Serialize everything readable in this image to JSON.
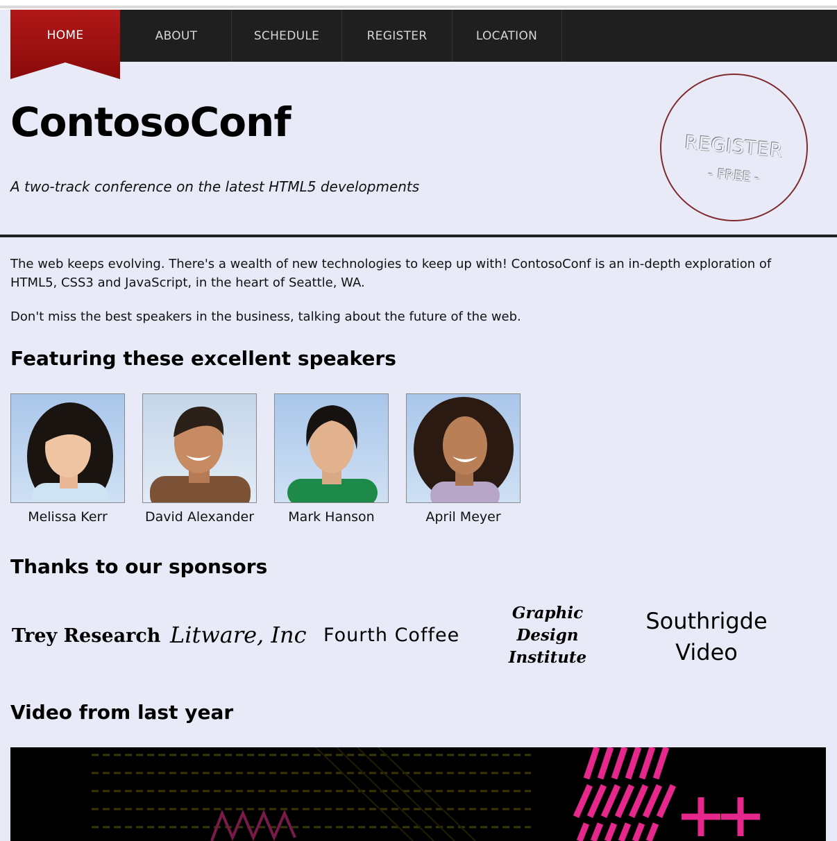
{
  "nav": {
    "items": [
      {
        "label": "HOME",
        "active": true
      },
      {
        "label": "ABOUT",
        "active": false
      },
      {
        "label": "SCHEDULE",
        "active": false
      },
      {
        "label": "REGISTER",
        "active": false
      },
      {
        "label": "LOCATION",
        "active": false
      }
    ]
  },
  "header": {
    "title": "ContosoConf",
    "tagline": "A two-track conference on the latest HTML5 developments",
    "stamp": {
      "main": "REGISTER",
      "sub": "- FREE -"
    }
  },
  "intro": {
    "paragraph1": "The web keeps evolving. There's a wealth of new technologies to keep up with! ContosoConf is an in-depth exploration of HTML5, CSS3 and JavaScript, in the heart of Seattle, WA.",
    "paragraph2": "Don't miss the best speakers in the business, talking about the future of the web."
  },
  "speakers": {
    "heading": "Featuring these excellent speakers",
    "list": [
      {
        "name": "Melissa Kerr"
      },
      {
        "name": "David Alexander"
      },
      {
        "name": "Mark Hanson"
      },
      {
        "name": "April Meyer"
      }
    ]
  },
  "sponsors": {
    "heading": "Thanks to our sponsors",
    "list": [
      {
        "name": "Trey Research"
      },
      {
        "name": "Litware, Inc"
      },
      {
        "name": "Fourth Coffee"
      },
      {
        "name": "Graphic Design Institute",
        "lines": [
          "Graphic",
          "Design",
          "Institute"
        ]
      },
      {
        "name": "Southrigde Video",
        "lines": [
          "Southrigde",
          "Video"
        ]
      }
    ]
  },
  "video": {
    "heading": "Video from last year"
  },
  "colors": {
    "nav_bg": "#1f1f1f",
    "active_tab": "#a01010",
    "page_bg": "#e8ebf7",
    "stamp_border": "#7f2a2e",
    "video_pink": "#e6288c"
  }
}
